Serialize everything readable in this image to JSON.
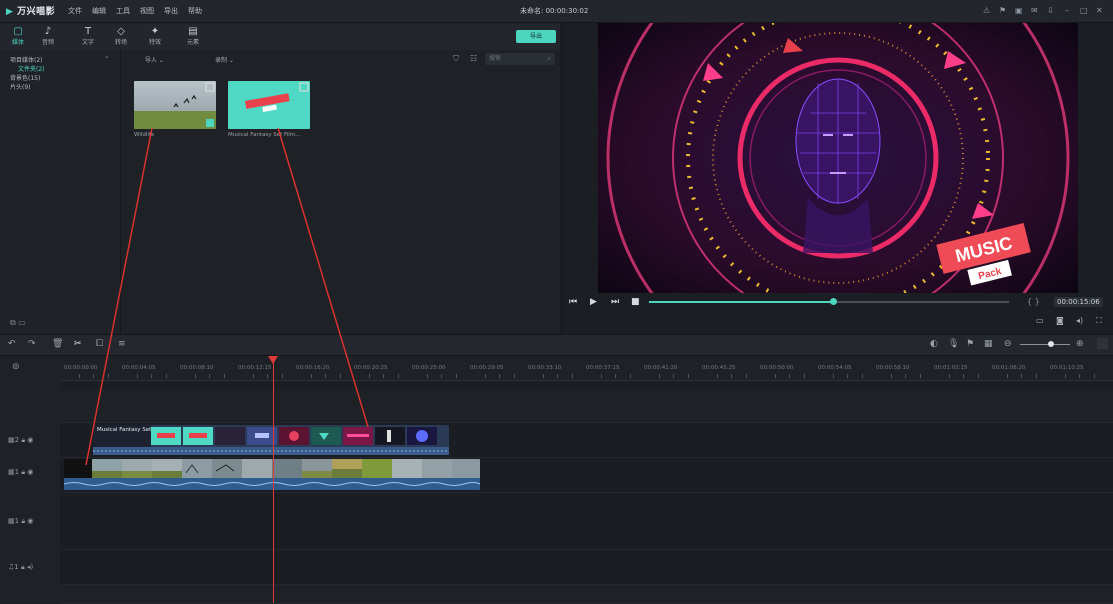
{
  "app": {
    "logo_text": "万兴喵影",
    "project_title": "未命名: 00:00:30:02"
  },
  "menu": [
    "文件",
    "编辑",
    "工具",
    "视图",
    "导出",
    "帮助"
  ],
  "window_icons": [
    "alert-icon",
    "gift-icon",
    "save-icon",
    "mail-icon",
    "download-icon",
    "minimize-icon",
    "maximize-icon",
    "close-icon"
  ],
  "toolbar": {
    "tools": [
      {
        "label": "媒体",
        "icon": "folder-icon"
      },
      {
        "label": "音频",
        "icon": "music-note-icon"
      },
      {
        "label": "文字",
        "icon": "text-icon"
      },
      {
        "label": "转场",
        "icon": "transition-icon"
      },
      {
        "label": "特效",
        "icon": "effects-icon"
      },
      {
        "label": "元素",
        "icon": "elements-icon"
      }
    ],
    "record_label": "导出"
  },
  "library": {
    "items": [
      {
        "label": "项目媒体(2)",
        "selected": false
      },
      {
        "label": "文件夹(2)",
        "selected": true
      },
      {
        "label": "背景色(15)",
        "selected": false
      },
      {
        "label": "片头(9)",
        "selected": false
      }
    ],
    "import_label": "导入",
    "record_label": "录制",
    "search_placeholder": "搜索",
    "media": [
      {
        "name": "Wildlife",
        "kind": "landscape"
      },
      {
        "name": "Musical Fantasy Set Film...",
        "kind": "title-card"
      }
    ]
  },
  "preview": {
    "overlay_title": "MUSIC",
    "overlay_subtitle": "Pack",
    "timecode": "00:00:15:06",
    "progress": 0.51
  },
  "timeline": {
    "ruler_labels": [
      "00:00:00:00",
      "00:00:04:05",
      "00:00:08:10",
      "00:00:12:15",
      "00:00:16:20",
      "00:00:20:25",
      "00:00:25:00",
      "00:00:29:05",
      "00:00:33:10",
      "00:00:37:15",
      "00:00:41:20",
      "00:00:45:25",
      "00:00:50:00",
      "00:00:54:05",
      "00:00:58:10",
      "00:01:02:15",
      "00:01:06:20",
      "00:01:10:25"
    ],
    "tracks": [
      {
        "label": "2",
        "kind": "video"
      },
      {
        "label": "1",
        "kind": "video"
      },
      {
        "label": "1",
        "kind": "video"
      },
      {
        "label": "1",
        "kind": "audio"
      }
    ],
    "clip_title": "Musical Fantasy Set"
  },
  "colors": {
    "accent": "#4cd6c0",
    "playhead": "#e03b3b",
    "bg": "#1b1e23"
  }
}
